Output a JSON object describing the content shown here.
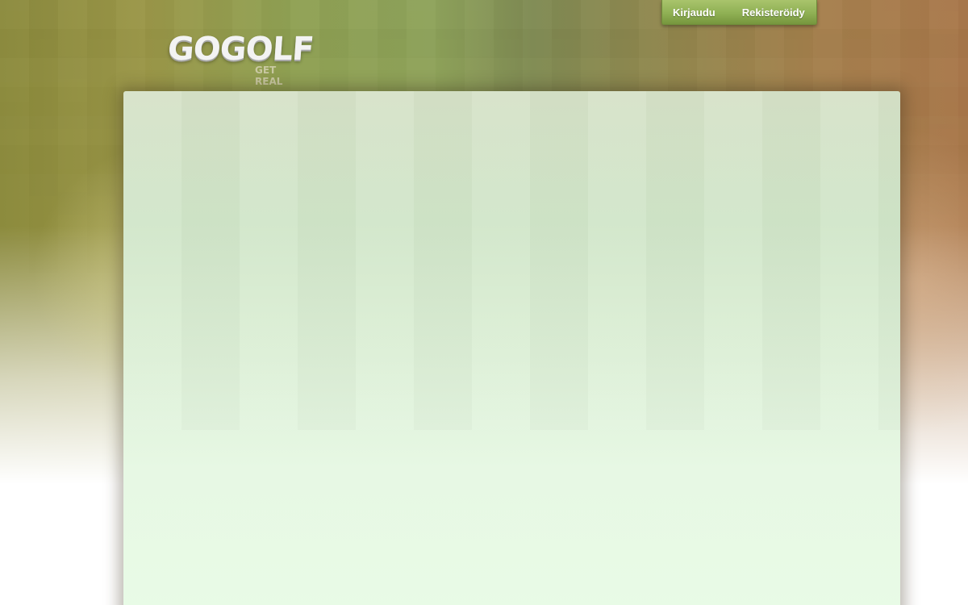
{
  "brand": {
    "name": "GOGOLF",
    "tagline": "GET REAL"
  },
  "auth": {
    "login_label": "Kirjaudu",
    "register_label": "Rekisteröidy"
  },
  "colors": {
    "accent_green": "#8fb054",
    "panel_bg": "#e8fbe6"
  }
}
